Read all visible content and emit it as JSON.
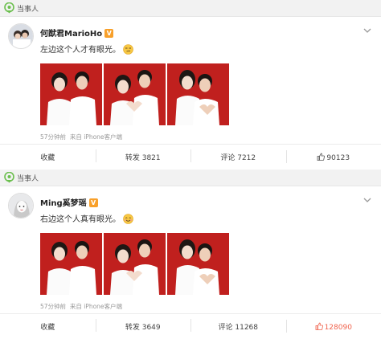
{
  "posts": [
    {
      "tag": "当事人",
      "username": "何猷君MarioHo",
      "verified_badge": "V",
      "text": "左边这个人才有眼光。",
      "emoji": "smirk-emoji",
      "meta_time": "57分钟前",
      "meta_source": "来自 iPhone客户端",
      "actions": {
        "favorite": "收藏",
        "repost": "转发 3821",
        "comment": "评论 7212",
        "like": "90123"
      },
      "liked": false
    },
    {
      "tag": "当事人",
      "username": "Ming奚梦瑶",
      "verified_badge": "V",
      "text": "右边这个人真有眼光。",
      "emoji": "smile-emoji",
      "meta_time": "57分钟前",
      "meta_source": "来自 iPhone客户端",
      "actions": {
        "favorite": "收藏",
        "repost": "转发 3649",
        "comment": "评论 11268",
        "like": "128090"
      },
      "liked": true
    }
  ],
  "colors": {
    "photo_background": "#c0201e",
    "verified": "#f8a02a",
    "liked": "#f0624c",
    "tag_green": "#6bbf4e"
  }
}
